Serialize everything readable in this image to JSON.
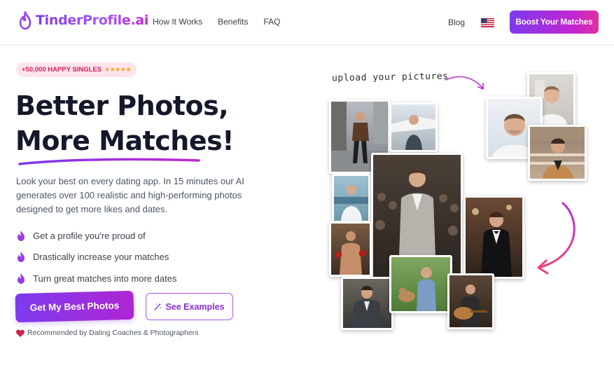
{
  "header": {
    "logo_text": "TinderProfile.ai",
    "nav": [
      "How It Works",
      "Benefits",
      "FAQ"
    ],
    "blog": "Blog",
    "boost_label": "Boost Your Matches"
  },
  "hero": {
    "badge_text": "+50,000 HAPPY SINGLES",
    "badge_stars": "★★★★★",
    "title_line1": "Better Photos,",
    "title_line2": "More Matches!",
    "description": "Look your best on every dating app. In 15 minutes our AI generates over 100 realistic and high-performing photos designed to get more likes and dates.",
    "bullets": [
      "Get a profile you're proud of",
      "Drastically increase your matches",
      "Turn great matches into more dates"
    ],
    "cta_label": "Get My Best Photos",
    "see_examples_label": "See Examples",
    "recommended_text": "Recommended by Dating Coaches & Photographers"
  },
  "gallery": {
    "upload_label": "upload your pictures"
  },
  "colors": {
    "brand_purple": "#7c3aed",
    "brand_pink": "#c026d3",
    "badge_bg": "#fde4ea",
    "title": "#15172b"
  }
}
